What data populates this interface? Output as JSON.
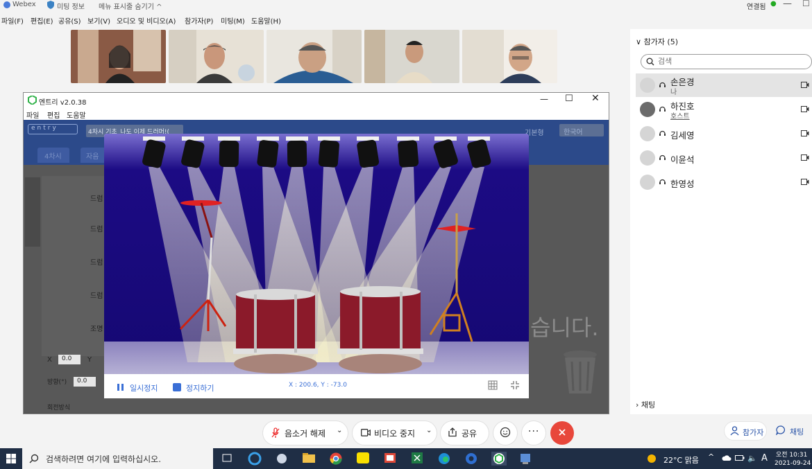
{
  "webex_title": {
    "app": "Webex",
    "meeting_info": "미팅 정보",
    "hide_menu": "메뉴 표시줄 숨기기",
    "connection": "연결됨"
  },
  "menu": [
    "파일(F)",
    "편집(E)",
    "공유(S)",
    "보기(V)",
    "오디오 및 비디오(A)",
    "참가자(P)",
    "미팅(M)",
    "도움말(H)"
  ],
  "participants_panel": {
    "title": "참가자 (5)",
    "search_placeholder": "검색",
    "people": [
      {
        "name": "손은경",
        "sub": "나"
      },
      {
        "name": "하진호",
        "sub": "호스트"
      },
      {
        "name": "김세영",
        "sub": ""
      },
      {
        "name": "이윤석",
        "sub": ""
      },
      {
        "name": "한영성",
        "sub": ""
      }
    ],
    "chat_section": "채팅",
    "participants_btn": "참가자",
    "chat_btn": "채팅"
  },
  "entry": {
    "title": "엔트리 v2.0.38",
    "menu": [
      "파일",
      "편집",
      "도움말"
    ],
    "project_name": "4차시 기초_나도 이제 드러머!(",
    "tabs": [
      "4차시",
      "자음"
    ],
    "mode": "기본형",
    "language": "한국어",
    "sprites": [
      "드럼",
      "드럼",
      "드럼",
      "드럼",
      "조명"
    ],
    "x_label": "X",
    "x_val": "0.0",
    "y_label": "Y",
    "dir_label": "방향(°)",
    "dir_val": "0.0",
    "rot_label": "회전방식",
    "bg_text": "습니다.",
    "stage": {
      "pause": "일시정지",
      "stop": "정지하기",
      "coords": "X : 200.6, Y : -73.0"
    }
  },
  "controls": {
    "mute": "음소거 해제",
    "video": "비디오 중지",
    "share": "공유"
  },
  "taskbar": {
    "search": "검색하려면 여기에 입력하십시오.",
    "weather": "22°C 맑음",
    "ime": "A",
    "time": "오전 10:31",
    "date": "2021-09-24"
  },
  "colors": {
    "host_blue": "#2c4a8a",
    "stage_bg": "#1a0a82",
    "drum_red": "#8b1a2a",
    "end_red": "#e8473b",
    "accent": "#2a54a8"
  }
}
